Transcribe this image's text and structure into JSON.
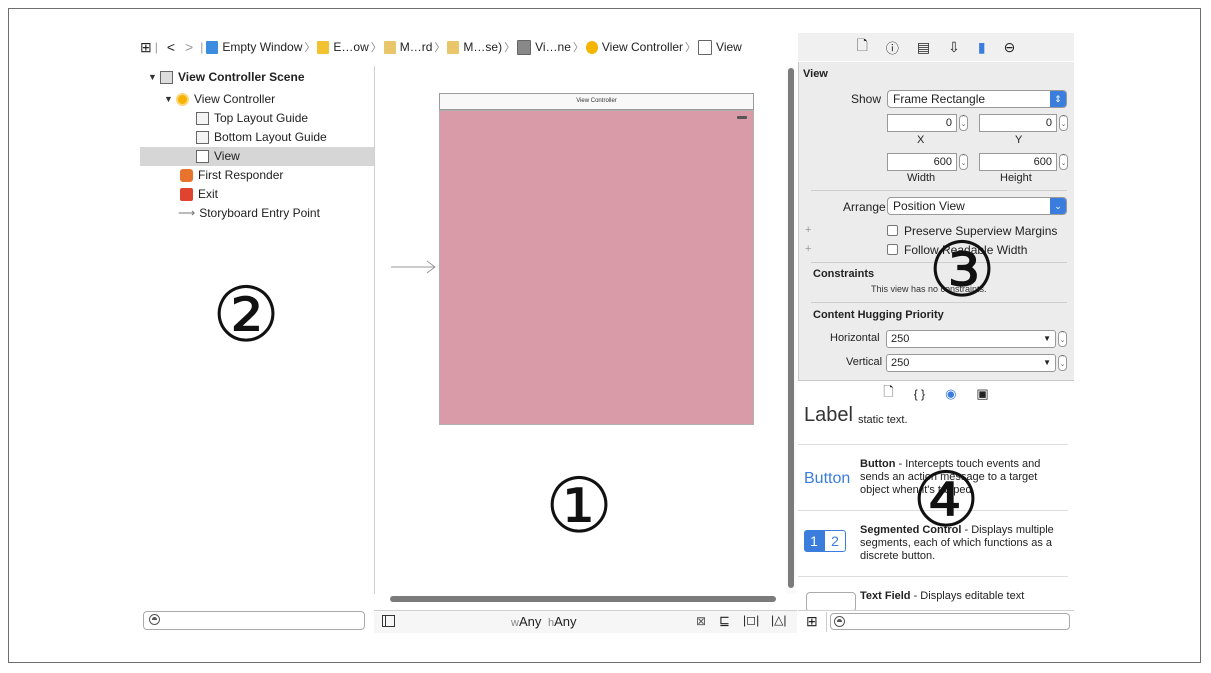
{
  "breadcrumbs": [
    {
      "label": "Empty Window",
      "icon": "file-icon",
      "color": "#3c8ce0"
    },
    {
      "label": "E…ow",
      "icon": "folder-icon",
      "color": "#f2c230"
    },
    {
      "label": "M…rd",
      "icon": "storyboard-icon",
      "color": "#e9c66a"
    },
    {
      "label": "M…se)",
      "icon": "storyboard-icon",
      "color": "#e9c66a"
    },
    {
      "label": "Vi…ne",
      "icon": "scene-icon",
      "color": "#888888"
    },
    {
      "label": "View Controller",
      "icon": "view-controller-icon",
      "color": "#f4b400"
    },
    {
      "label": "View",
      "icon": "view-icon",
      "color": "#ffffff"
    }
  ],
  "outline": {
    "scene": "View Controller Scene",
    "controller": "View Controller",
    "top_guide": "Top Layout Guide",
    "bottom_guide": "Bottom Layout Guide",
    "view": "View",
    "first_responder": "First Responder",
    "exit": "Exit",
    "entry_point": "Storyboard Entry Point"
  },
  "annotations": {
    "canvas": "①",
    "outline": "②",
    "inspector": "③",
    "library": "④"
  },
  "canvas": {
    "vc_title": "View Controller",
    "view_color": "#d89ba7"
  },
  "size_class": {
    "w_prefix": "w",
    "w_value": "Any",
    "h_prefix": "h",
    "h_value": "Any"
  },
  "inspector": {
    "section": "View",
    "show_label": "Show",
    "show_value": "Frame Rectangle",
    "x_value": "0",
    "y_value": "0",
    "x_label": "X",
    "y_label": "Y",
    "width_value": "600",
    "height_value": "600",
    "width_label": "Width",
    "height_label": "Height",
    "arrange_label": "Arrange",
    "arrange_value": "Position View",
    "preserve_margins": "Preserve Superview Margins",
    "follow_width": "Follow Readable Width",
    "constraints_title": "Constraints",
    "constraints_text": "This view has no constraints.",
    "hugging_title": "Content Hugging Priority",
    "horizontal_label": "Horizontal",
    "horizontal_value": "250",
    "vertical_label": "Vertical",
    "vertical_value": "250"
  },
  "library": {
    "label_preview": "Label",
    "label_desc": "static text.",
    "button_preview": "Button",
    "button_title": "Button",
    "button_desc": " - Intercepts touch events and sends an action message to a target object when it's tapped.",
    "segmented_1": "1",
    "segmented_2": "2",
    "segmented_title": "Segmented Control",
    "segmented_desc": " - Displays multiple segments, each of which functions as a discrete button.",
    "textfield_title": "Text Field",
    "textfield_desc": " - Displays editable text"
  }
}
